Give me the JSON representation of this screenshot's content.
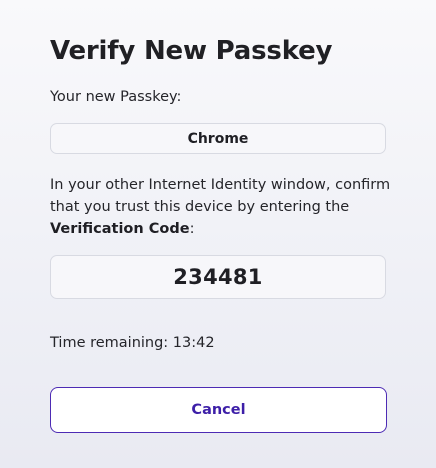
{
  "title": "Verify New Passkey",
  "passkey": {
    "label": "Your new Passkey:",
    "value": "Chrome"
  },
  "instructions": {
    "text": "In your other Internet Identity window, confirm that you trust this device by entering the ",
    "emphasis": "Verification Code",
    "suffix": ":"
  },
  "verification": {
    "code": "234481"
  },
  "timer": {
    "text": "Time remaining: 13:42"
  },
  "actions": {
    "cancel_label": "Cancel"
  },
  "colors": {
    "accent": "#3d1fa8",
    "accent_border": "#4d2bb4",
    "field_background": "#f7f7fa"
  }
}
